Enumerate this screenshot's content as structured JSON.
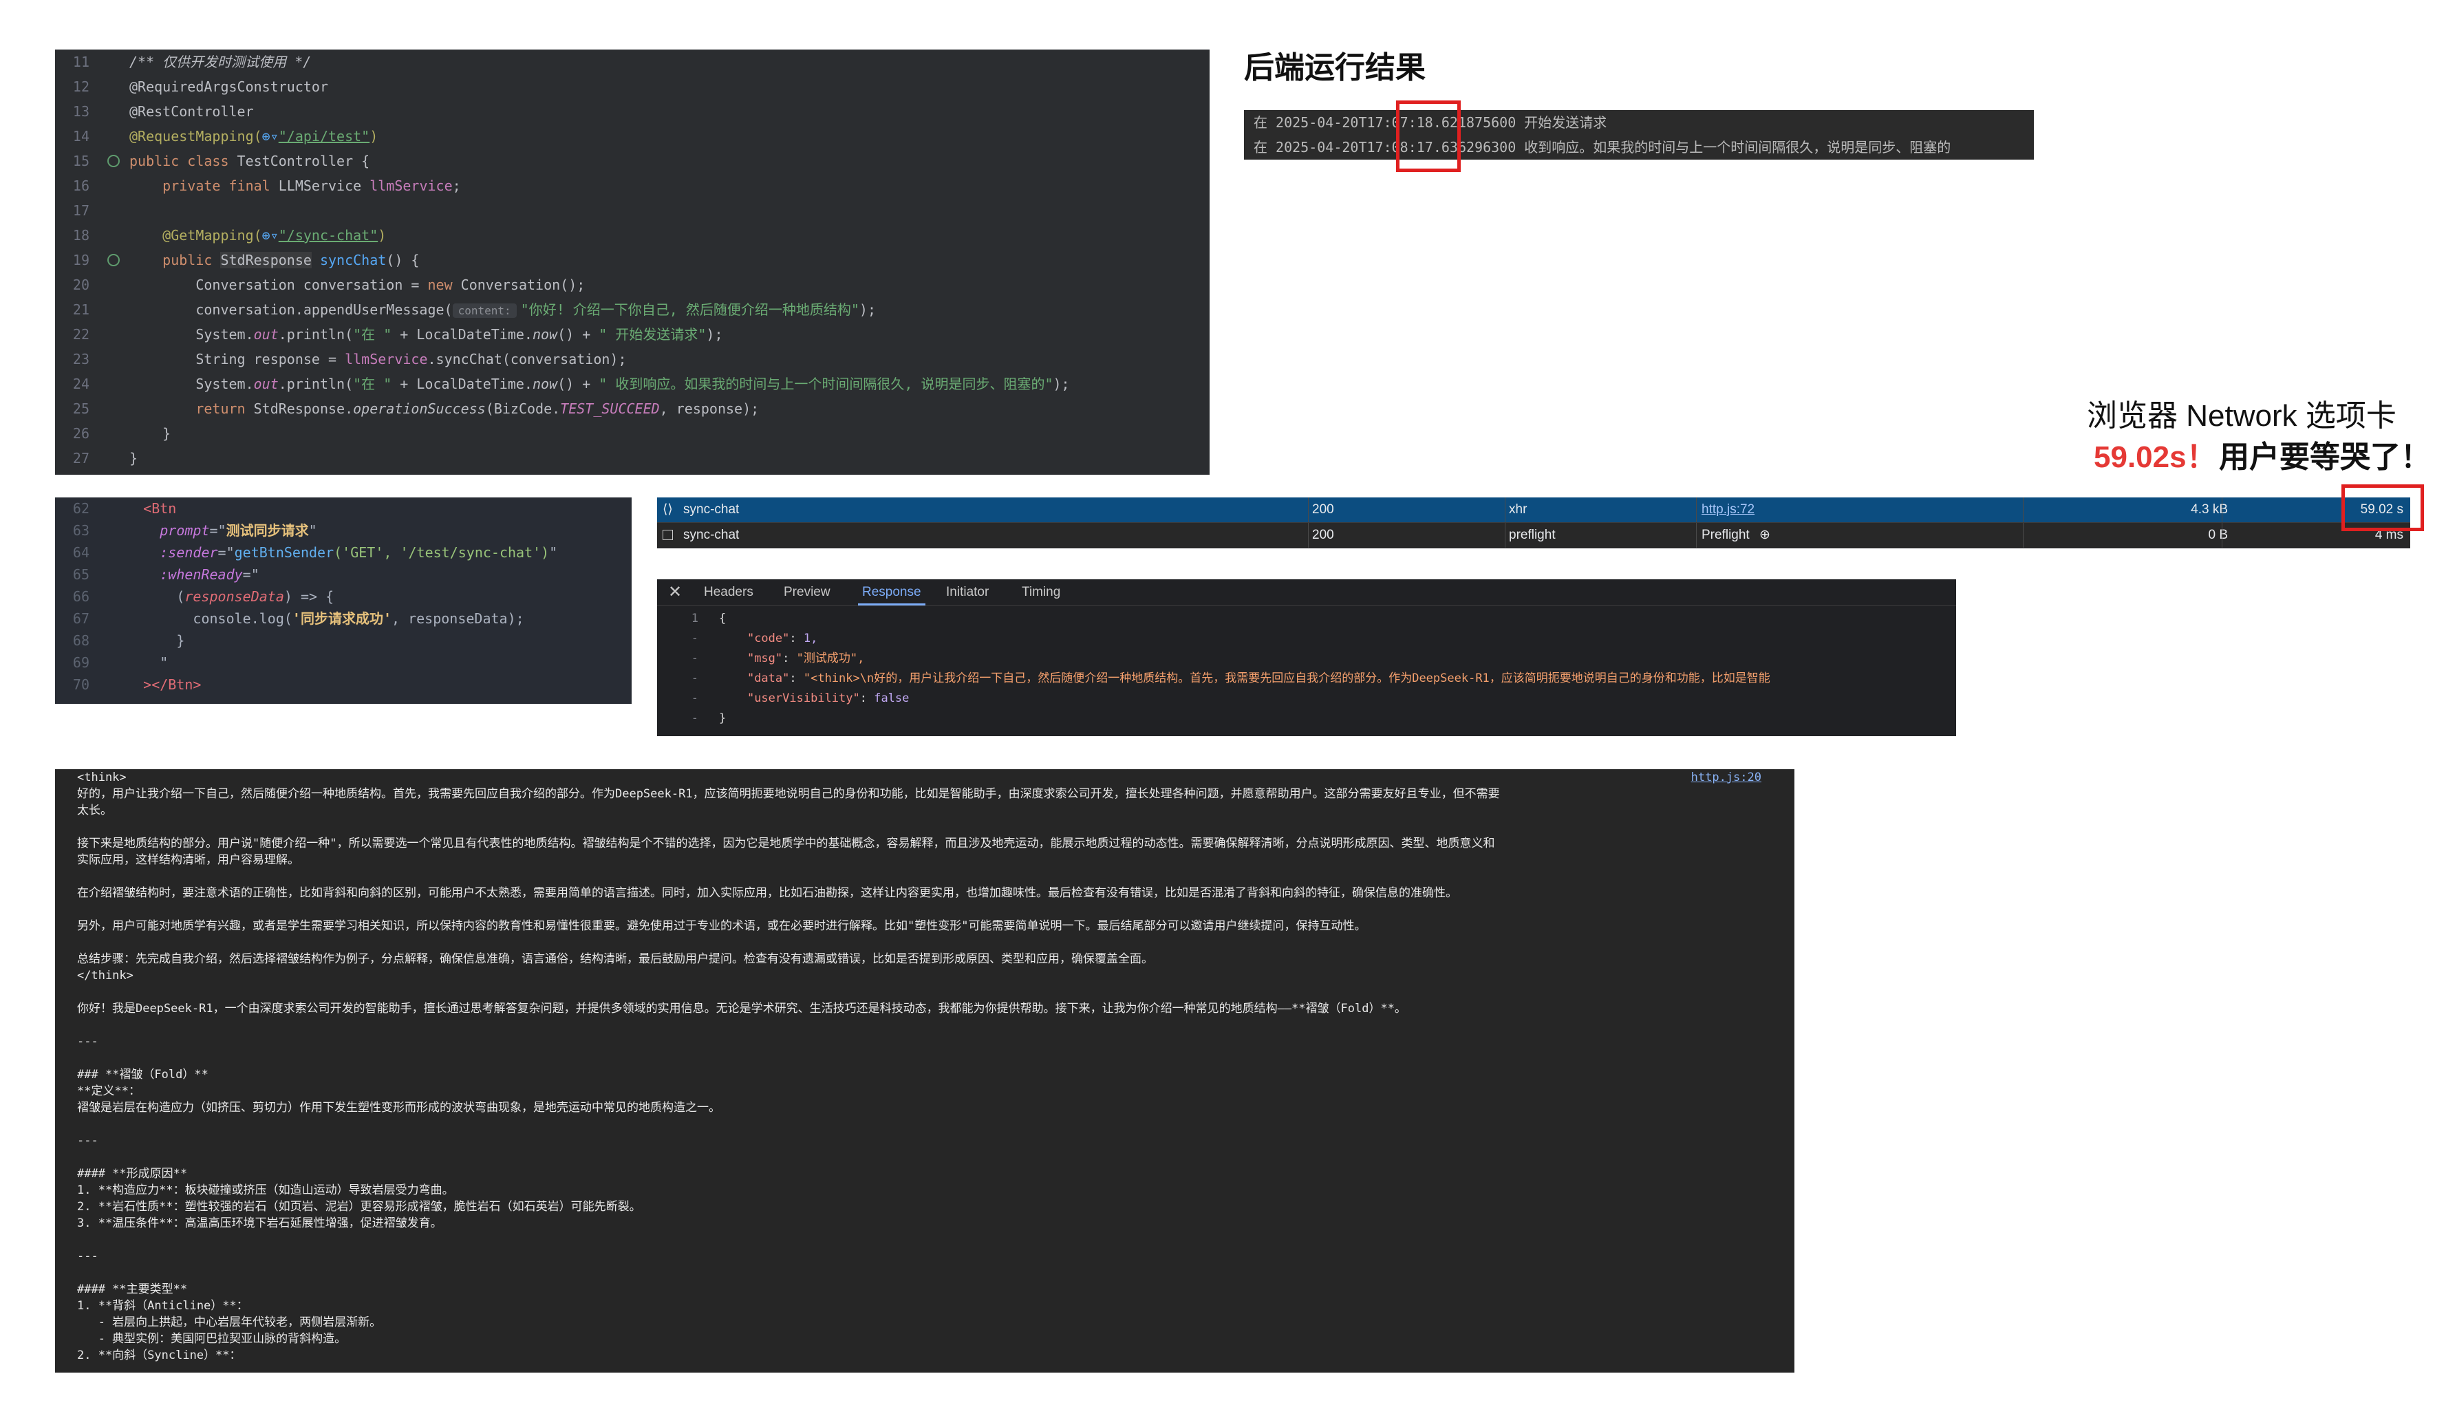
{
  "java_editor": {
    "lines": [
      {
        "n": "11",
        "text": "/** 仅供开发时测试使用 */"
      },
      {
        "n": "12",
        "text": "@RequiredArgsConstructor"
      },
      {
        "n": "13",
        "text": "@RestController"
      },
      {
        "n": "14",
        "text": "@RequestMapping(",
        "link": "\"/api/test\"",
        "tail": ")"
      },
      {
        "n": "15",
        "kw": "public class ",
        "text": "TestController {"
      },
      {
        "n": "16",
        "kw": "    private final ",
        "text": "LLMService ",
        "field": "llmService",
        "tail": ";"
      },
      {
        "n": "17",
        "text": ""
      },
      {
        "n": "18",
        "text": "    @GetMapping(",
        "link": "\"/sync-chat\"",
        "tail": ")"
      },
      {
        "n": "19",
        "kw": "    public ",
        "hl": "StdResponse",
        "fn": " syncChat",
        "tail": "() {"
      },
      {
        "n": "20",
        "text": "        Conversation conversation = ",
        "kw2": "new ",
        "tail": "Conversation();"
      },
      {
        "n": "21",
        "text": "        conversation.appendUserMessage(",
        "hint": "content:",
        "str": "\"你好! 介绍一下你自己, 然后随便介绍一种地质结构\"",
        "tail": ");"
      },
      {
        "n": "22",
        "text": "        System.",
        "f": "out",
        "t2": ".println(",
        "str": "\"在 \"",
        "t3": " + LocalDateTime.",
        "it": "now",
        "t4": "() + ",
        "str2": "\" 开始发送请求\"",
        "tail": ");"
      },
      {
        "n": "23",
        "text": "        String response = ",
        "field": "llmService",
        "tail": ".syncChat(conversation);"
      },
      {
        "n": "24",
        "text": "        System.",
        "f": "out",
        "t2": ".println(",
        "str": "\"在 \"",
        "t3": " + LocalDateTime.",
        "it": "now",
        "t4": "() + ",
        "str2": "\" 收到响应。如果我的时间与上一个时间间隔很久, 说明是同步、阻塞的\"",
        "tail": ");"
      },
      {
        "n": "25",
        "kw": "        return ",
        "text": "StdResponse.",
        "it": "operationSuccess",
        "t2": "(BizCode.",
        "cst": "TEST_SUCCEED",
        "tail": ", response);"
      },
      {
        "n": "26",
        "text": "    }"
      },
      {
        "n": "27",
        "text": "}"
      }
    ]
  },
  "backend": {
    "title": "后端运行结果",
    "lines": [
      "在 2025-04-20T17:07:18.621875600 开始发送请求",
      "在 2025-04-20T17:08:17.636296300 收到响应。如果我的时间与上一个时间间隔很久，说明是同步、阻塞的"
    ]
  },
  "caption": {
    "line1": "浏览器 Network 选项卡",
    "red": "59.02s！",
    "black": "用户要等哭了！"
  },
  "network": {
    "rows": [
      {
        "name": "sync-chat",
        "status": "200",
        "type": "xhr",
        "initiator": "http.js:72",
        "size": "4.3 kB",
        "time": "59.02 s"
      },
      {
        "name": "sync-chat",
        "status": "200",
        "type": "preflight",
        "initiator": "Preflight",
        "size": "0 B",
        "time": "4 ms"
      }
    ]
  },
  "vue_editor": {
    "lines": [
      "62",
      "63",
      "64",
      "65",
      "66",
      "67",
      "68",
      "69",
      "70"
    ],
    "btn_open": "<Btn",
    "prompt_attr": "prompt",
    "prompt_val": "测试同步请求",
    "sender_attr": ":sender",
    "sender_fn": "getBtnSender",
    "sender_args": "('GET', '/test/sync-chat')",
    "ready_attr": ":whenReady",
    "param": "responseData",
    "log_fn": "console.log(",
    "log_str": "'同步请求成功'",
    "log_tail": ", responseData);",
    "btn_close": "></Btn>"
  },
  "response": {
    "tabs": [
      "Headers",
      "Preview",
      "Response",
      "Initiator",
      "Timing"
    ],
    "active_tab": "Response",
    "gutter": [
      "1",
      "-",
      "-",
      "-",
      "-",
      "-"
    ],
    "code_key": "\"code\"",
    "code_val": "1,",
    "msg_key": "\"msg\"",
    "msg_val": "\"测试成功\",",
    "data_key": "\"data\"",
    "data_val": "\"<think>\\n好的，用户让我介绍一下自己，然后随便介绍一种地质结构。首先，我需要先回应自我介绍的部分。作为DeepSeek-R1，应该简明扼要地说明自己的身份和功能，比如是智能",
    "vis_key": "\"userVisibility\"",
    "vis_val": "false"
  },
  "console_output": {
    "link": "http.js:20",
    "lines": [
      "<think>",
      "好的，用户让我介绍一下自己，然后随便介绍一种地质结构。首先，我需要先回应自我介绍的部分。作为DeepSeek-R1，应该简明扼要地说明自己的身份和功能，比如是智能助手，由深度求索公司开发，擅长处理各种问题，并愿意帮助用户。这部分需要友好且专业，但不需要",
      "太长。",
      "",
      "接下来是地质结构的部分。用户说\"随便介绍一种\"，所以需要选一个常见且有代表性的地质结构。褶皱结构是个不错的选择，因为它是地质学中的基础概念，容易解释，而且涉及地壳运动，能展示地质过程的动态性。需要确保解释清晰，分点说明形成原因、类型、地质意义和",
      "实际应用，这样结构清晰，用户容易理解。",
      "",
      "在介绍褶皱结构时，要注意术语的正确性，比如背斜和向斜的区别，可能用户不太熟悉，需要用简单的语言描述。同时，加入实际应用，比如石油勘探，这样让内容更实用，也增加趣味性。最后检查有没有错误，比如是否混淆了背斜和向斜的特征，确保信息的准确性。",
      "",
      "另外，用户可能对地质学有兴趣，或者是学生需要学习相关知识，所以保持内容的教育性和易懂性很重要。避免使用过于专业的术语，或在必要时进行解释。比如\"塑性变形\"可能需要简单说明一下。最后结尾部分可以邀请用户继续提问，保持互动性。",
      "",
      "总结步骤：先完成自我介绍，然后选择褶皱结构作为例子，分点解释，确保信息准确，语言通俗，结构清晰，最后鼓励用户提问。检查有没有遗漏或错误，比如是否提到形成原因、类型和应用，确保覆盖全面。",
      "</think>",
      "",
      "你好！我是DeepSeek-R1，一个由深度求索公司开发的智能助手，擅长通过思考解答复杂问题，并提供多领域的实用信息。无论是学术研究、生活技巧还是科技动态，我都能为你提供帮助。接下来，让我为你介绍一种常见的地质结构——**褶皱（Fold）**。",
      "",
      "---",
      "",
      "### **褶皱（Fold）**",
      "**定义**：",
      "褶皱是岩层在构造应力（如挤压、剪切力）作用下发生塑性变形而形成的波状弯曲现象，是地壳运动中常见的地质构造之一。",
      "",
      "---",
      "",
      "#### **形成原因**",
      "1. **构造应力**：板块碰撞或挤压（如造山运动）导致岩层受力弯曲。",
      "2. **岩石性质**：塑性较强的岩石（如页岩、泥岩）更容易形成褶皱，脆性岩石（如石英岩）可能先断裂。",
      "3. **温压条件**：高温高压环境下岩石延展性增强，促进褶皱发育。",
      "",
      "---",
      "",
      "#### **主要类型**",
      "1. **背斜（Anticline）**：",
      "   - 岩层向上拱起，中心岩层年代较老，两侧岩层渐新。",
      "   - 典型实例：美国阿巴拉契亚山脉的背斜构造。",
      "2. **向斜（Syncline）**："
    ]
  }
}
